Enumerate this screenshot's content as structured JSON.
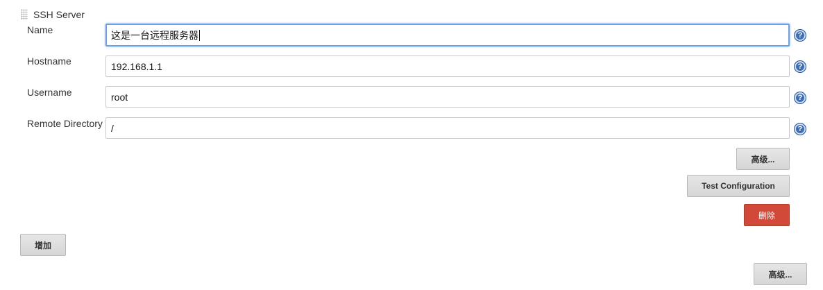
{
  "section": {
    "title": "SSH Server"
  },
  "fields": {
    "name": {
      "label": "Name",
      "value": "这是一台远程服务器"
    },
    "hostname": {
      "label": "Hostname",
      "value": "192.168.1.1"
    },
    "username": {
      "label": "Username",
      "value": "root"
    },
    "remote_directory": {
      "label": "Remote Directory",
      "value": "/"
    }
  },
  "help_glyph": "?",
  "buttons": {
    "advanced": "高级...",
    "test_configuration": "Test Configuration",
    "delete": "删除",
    "add": "增加",
    "advanced_outer": "高级..."
  },
  "colors": {
    "focus_border": "#6aa0e8",
    "help_icon": "#3e6fb4",
    "delete_button": "#d24939"
  }
}
